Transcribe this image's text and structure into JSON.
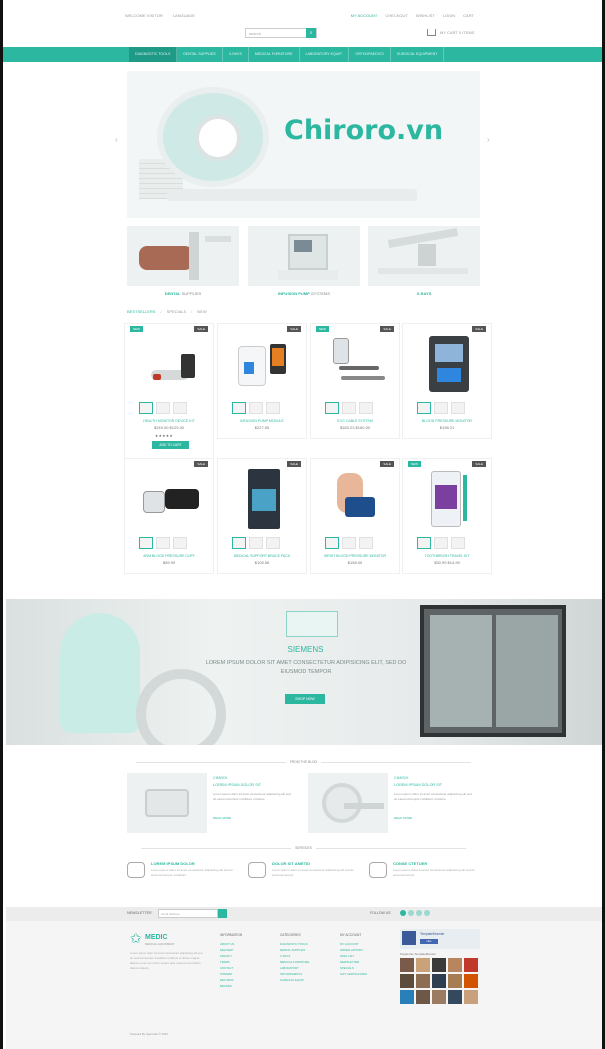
{
  "topbar": {
    "left": [
      "WELCOME VISITOR",
      "LANGUAGE"
    ],
    "right": [
      "MY ACCOUNT",
      "CHECKOUT",
      "WISHLIST",
      "LOGIN",
      "CART"
    ]
  },
  "search": {
    "placeholder": "search"
  },
  "cart": {
    "label": "MY CART 0 ITEMS"
  },
  "nav": [
    "DIAGNOSTIC TOOLS",
    "DENTAL SUPPLIES",
    "X-RAYS",
    "MEDICAL FURNITURE",
    "LABORATORY EQUIP.",
    "ORTHOPAEDICS",
    "SURGICAL EQUIPMENT"
  ],
  "hero": {
    "brand": "Chiroro.vn"
  },
  "categories": [
    {
      "bold": "DENTAL",
      "rest": " SUPPLIES"
    },
    {
      "bold": "INFUSION PUMP",
      "rest": " SYSTEMS"
    },
    {
      "bold": "X-RAYS",
      "rest": ""
    }
  ],
  "tabs": [
    "BESTSELLERS",
    "SPECIALS",
    "NEW"
  ],
  "products": [
    {
      "badge_new": "NEW",
      "badge_sale": "SALE",
      "name": "HEALTH MONITOR DEVICE KIT",
      "price": "$249.00 $129.00",
      "stars": "★★★★★",
      "button": "ADD TO CART"
    },
    {
      "badge_new": "",
      "badge_sale": "SALE",
      "name": "INFUSION PUMP MODULE",
      "price": "$227.95",
      "stars": "",
      "button": ""
    },
    {
      "badge_new": "NEW",
      "badge_sale": "SALE",
      "name": "ECG CABLE SYSTEM",
      "price": "$183.23 $160.00",
      "stars": "",
      "button": ""
    },
    {
      "badge_new": "",
      "badge_sale": "SALE",
      "name": "BLOOD PRESSURE MONITOR",
      "price": "$198.21",
      "stars": "",
      "button": ""
    },
    {
      "badge_new": "",
      "badge_sale": "SALE",
      "name": "ARM BLOOD PRESSURE CUFF",
      "price": "$59.99",
      "stars": "",
      "button": ""
    },
    {
      "badge_new": "",
      "badge_sale": "SALE",
      "name": "MEDICAL SUPPORT BRACE PACK",
      "price": "$105.56",
      "stars": "",
      "button": ""
    },
    {
      "badge_new": "",
      "badge_sale": "SALE",
      "name": "WRIST BLOOD PRESSURE MONITOR",
      "price": "$158.00",
      "stars": "",
      "button": ""
    },
    {
      "badge_new": "NEW",
      "badge_sale": "SALE",
      "name": "TOOTHBRUSH TRAVEL KIT",
      "price": "$30.99 $14.99",
      "stars": "",
      "button": ""
    }
  ],
  "banner": {
    "title": "SIEMENS",
    "text": "LOREM IPSUM DOLOR SIT AMET CONSECTETUR ADIPISICING ELIT, SED DO EIUSMOD TEMPOR",
    "button": "SHOP NOW"
  },
  "from_blog": {
    "title": "FROM THE BLOG",
    "posts": [
      {
        "date": "2 MARCH",
        "title": "LOREM IPSUM DOLOR SIT",
        "text": "Lorem ipsum dolor sit amet consectetur adipisicing elit sed do eiusmod tempor incididunt ut labore",
        "more": "READ MORE"
      },
      {
        "date": "2 MARCH",
        "title": "LOREM IPSUM DOLOR SIT",
        "text": "Lorem ipsum dolor sit amet consectetur adipisicing elit sed do eiusmod tempor incididunt ut labore",
        "more": "READ MORE"
      }
    ]
  },
  "services": {
    "title": "SERVICES",
    "items": [
      {
        "title": "LOREM IPSUM DOLOR",
        "text": "Lorem ipsum dolor sit amet consectetur adipisicing elit sed do eiusmod tempor incididunt"
      },
      {
        "title": "DOLOR SIT AMETID",
        "text": "Lorem ipsum dolor sit amet consectetur adipisicing elit sed do eiusmod tempor"
      },
      {
        "title": "CONSE CTETUER",
        "text": "Lorem ipsum dolor sit amet consectetur adipisicing elit sed do eiusmod tempor"
      }
    ]
  },
  "footer": {
    "newsletter_label": "NEWSLETTER",
    "newsletter_placeholder": "email address",
    "follow_label": "FOLLOW US",
    "logo_name": "MEDIC",
    "logo_sub": "MEDICAL EQUIPMENT",
    "logo_text": "Lorem ipsum dolor sit amet consectetur adipisicing elit sed do eiusmod tempor incididunt ut labore et dolore magna aliqua ut enim ad minim veniam quis nostrud exercitation ullamco laboris",
    "columns": [
      {
        "title": "INFORMATION",
        "items": [
          "ABOUT US",
          "DELIVERY",
          "PRIVACY",
          "TERMS",
          "CONTACT",
          "SITEMAP",
          "RETURNS",
          "BRANDS"
        ]
      },
      {
        "title": "CATEGORIES",
        "items": [
          "DIAGNOSTIC TOOLS",
          "DENTAL SUPPLIES",
          "X-RAYS",
          "MEDICAL FURNITURE",
          "LABORATORY",
          "ORTHOPAEDICS",
          "SURGICAL EQUIP."
        ]
      },
      {
        "title": "MY ACCOUNT",
        "items": [
          "MY ACCOUNT",
          "ORDER HISTORY",
          "WISH LIST",
          "NEWSLETTER",
          "SPECIALS",
          "GIFT CERTIFICATES"
        ]
      }
    ],
    "facebook": {
      "name": "TemplateMonster",
      "like": "Like",
      "caption": "People like TemplateMonster"
    },
    "copyright": "Powered By OpenCart © 2015"
  },
  "colors": {
    "accent": "#2cb7a0",
    "dark": "#555555"
  }
}
